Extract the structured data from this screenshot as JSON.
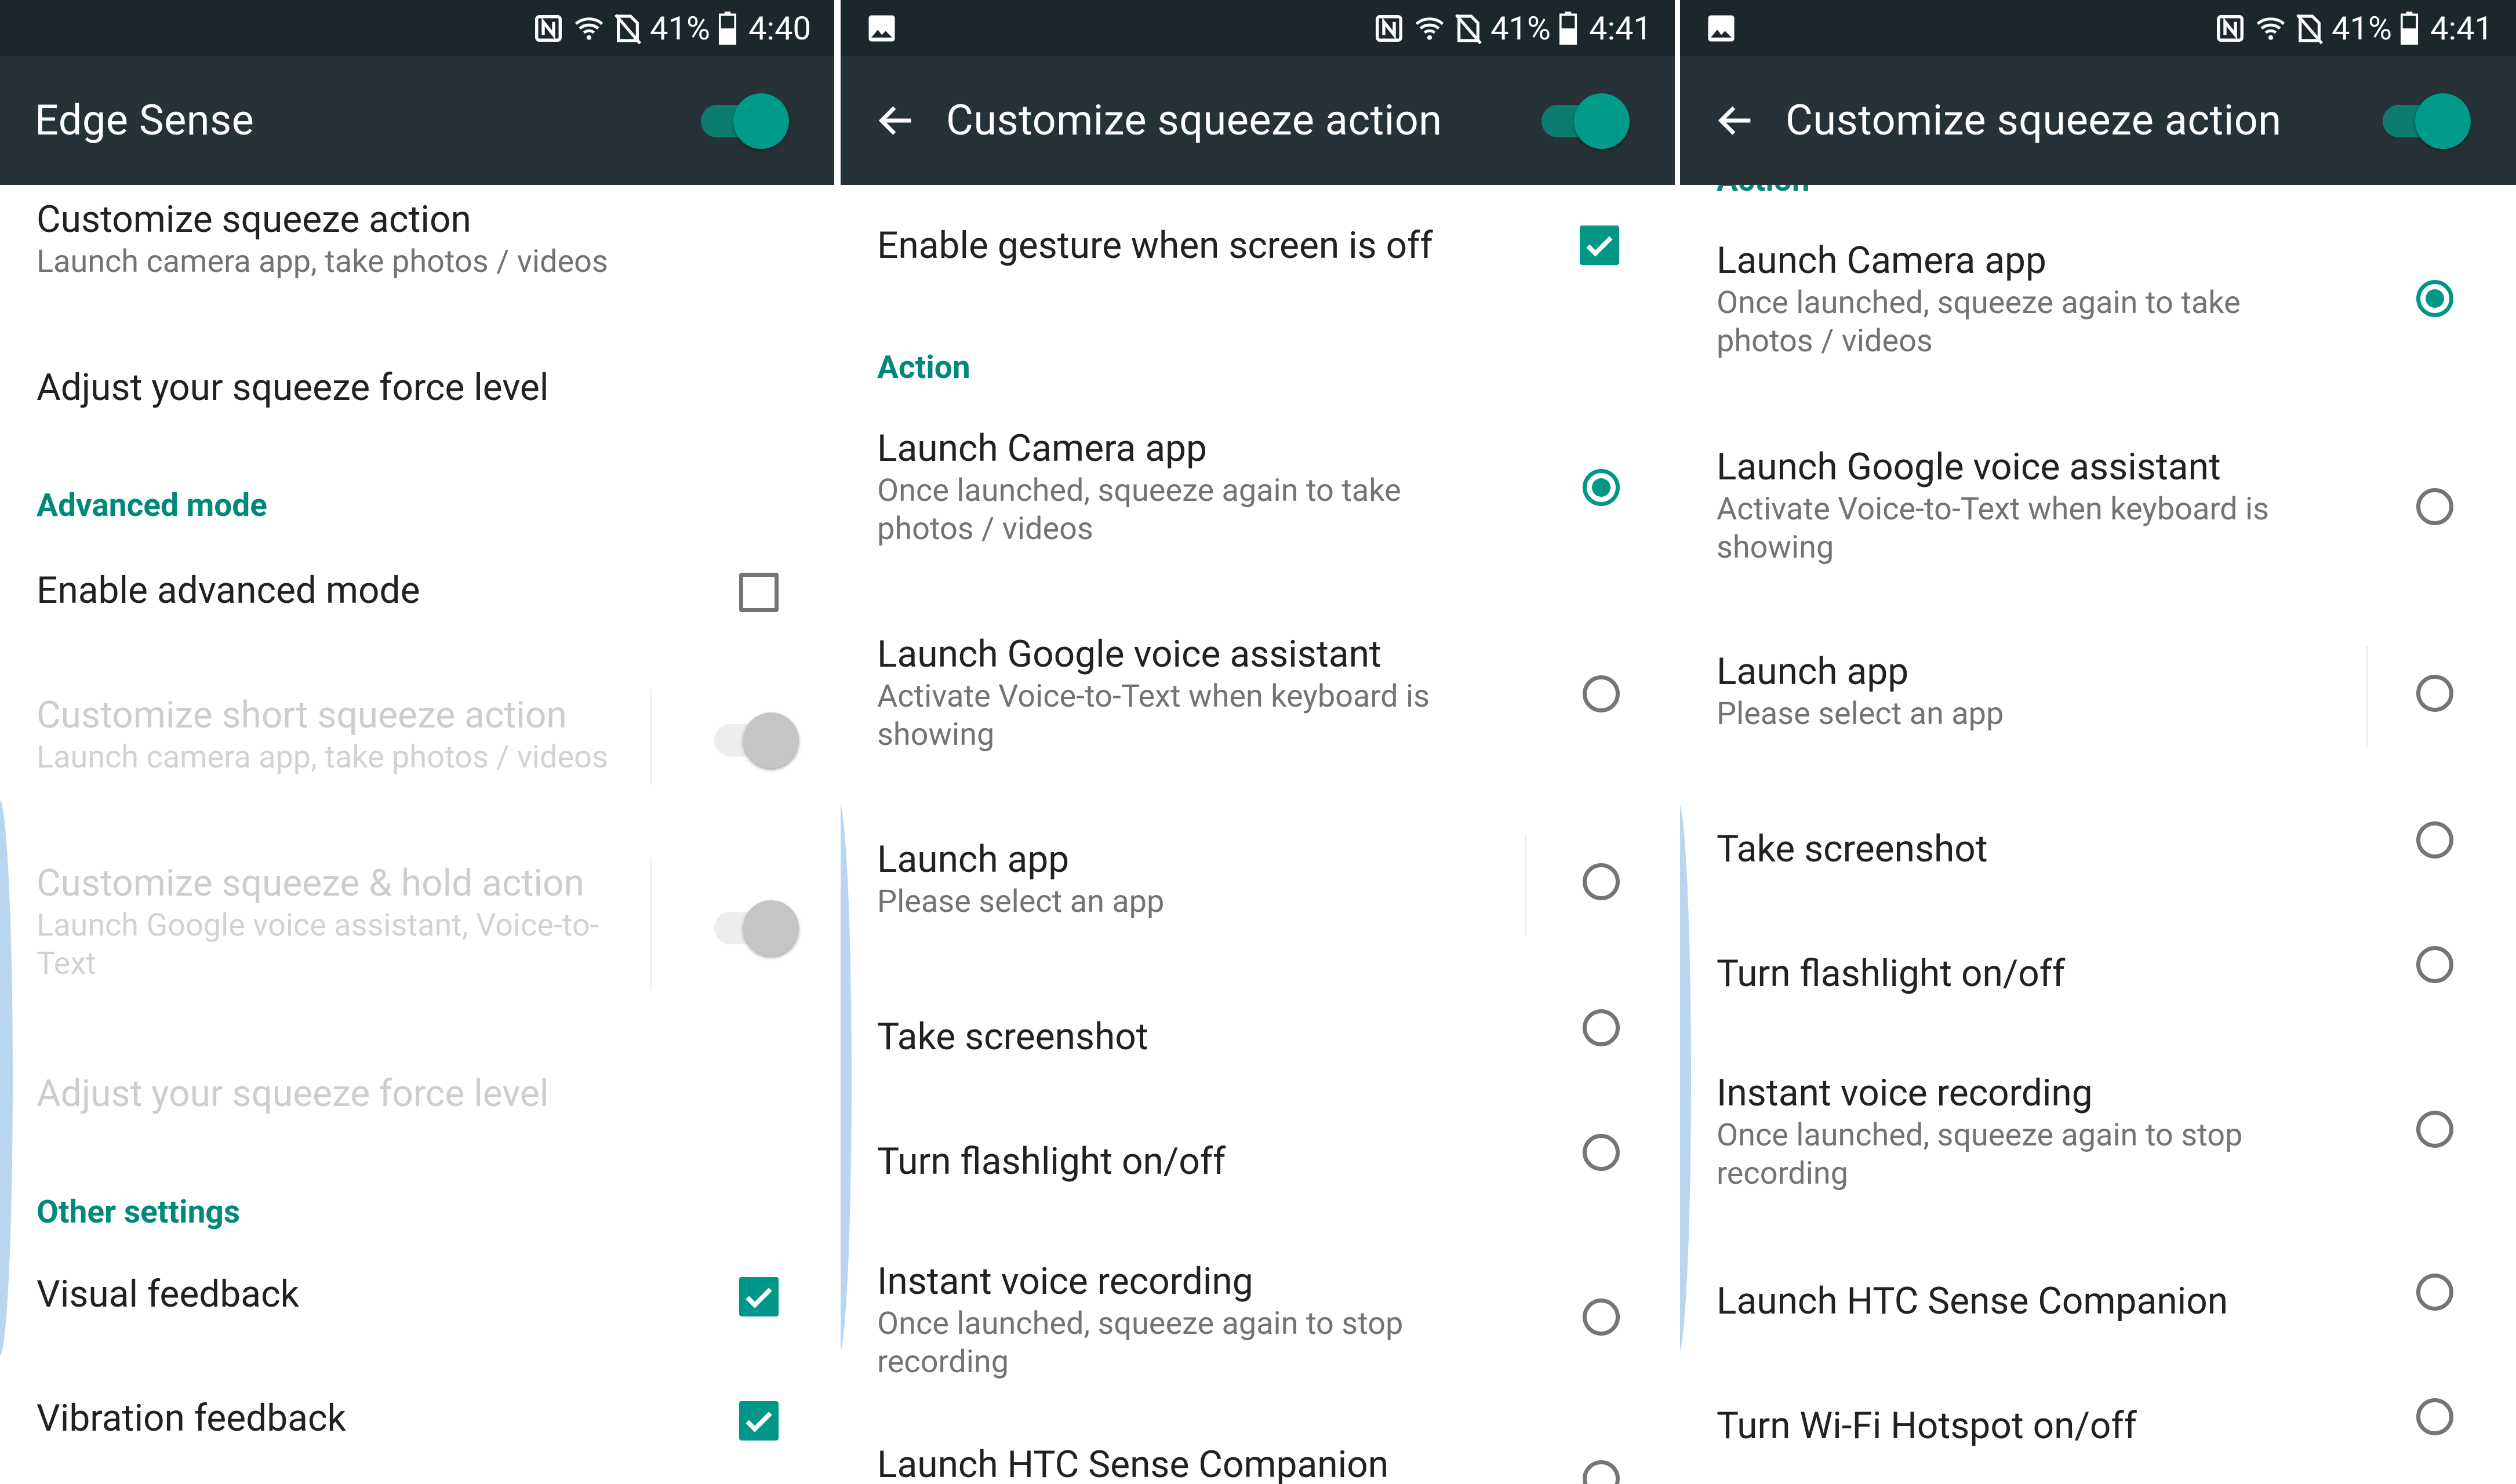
{
  "status_bar": {
    "battery": "41%",
    "panels": [
      {
        "time": "4:40"
      },
      {
        "time": "4:41"
      },
      {
        "time": "4:41"
      }
    ]
  },
  "panel1": {
    "title": "Edge Sense",
    "toggle_on": true,
    "items": [
      {
        "title": "Customize squeeze action",
        "subtitle": "Launch camera app, take photos / videos"
      },
      {
        "title": "Adjust your squeeze force level"
      },
      {
        "section": "Advanced mode"
      },
      {
        "title": "Enable advanced mode",
        "checked": false
      },
      {
        "title": "Customize short squeeze action",
        "subtitle": "Launch camera app, take photos / videos",
        "disabled": true,
        "toggle_on": false
      },
      {
        "title": "Customize squeeze & hold action",
        "subtitle": "Launch Google voice assistant, Voice-to-Text",
        "disabled": true,
        "toggle_on": false
      },
      {
        "title": "Adjust your squeeze force level",
        "disabled": true
      },
      {
        "section": "Other settings"
      },
      {
        "title": "Visual feedback",
        "checked": true
      },
      {
        "title": "Vibration feedback",
        "checked": true
      }
    ]
  },
  "panel2": {
    "title": "Customize squeeze action",
    "toggle_on": true,
    "enable_gesture": {
      "title": "Enable gesture when screen is off",
      "checked": true
    },
    "section": "Action",
    "options": [
      {
        "title": "Launch Camera app",
        "subtitle": "Once launched, squeeze again to take photos / videos",
        "selected": true
      },
      {
        "title": "Launch Google voice assistant",
        "subtitle": "Activate Voice-to-Text when keyboard is showing",
        "selected": false
      },
      {
        "title": "Launch app",
        "subtitle": "Please select an app",
        "selected": false
      },
      {
        "title": "Take screenshot",
        "selected": false
      },
      {
        "title": "Turn flashlight on/off",
        "selected": false
      },
      {
        "title": "Instant voice recording",
        "subtitle": "Once launched, squeeze again to stop recording",
        "selected": false
      },
      {
        "title": "Launch HTC Sense Companion",
        "selected": false
      }
    ]
  },
  "panel3": {
    "title": "Customize squeeze action",
    "toggle_on": true,
    "section": "Action",
    "options": [
      {
        "title": "Launch Camera app",
        "subtitle": "Once launched, squeeze again to take photos / videos",
        "selected": true
      },
      {
        "title": "Launch Google voice assistant",
        "subtitle": "Activate Voice-to-Text when keyboard is showing",
        "selected": false
      },
      {
        "title": "Launch app",
        "subtitle": "Please select an app",
        "selected": false
      },
      {
        "title": "Take screenshot",
        "selected": false
      },
      {
        "title": "Turn flashlight on/off",
        "selected": false
      },
      {
        "title": "Instant voice recording",
        "subtitle": "Once launched, squeeze again to stop recording",
        "selected": false
      },
      {
        "title": "Launch HTC Sense Companion",
        "selected": false
      },
      {
        "title": "Turn Wi-Fi Hotspot on/off",
        "selected": false
      }
    ]
  },
  "colors": {
    "status_bar": "#1c272b",
    "app_bar": "#263238",
    "accent": "#009688",
    "section_text": "#00897b",
    "edge_hint": "#b8d6f0"
  },
  "icons": [
    "nfc-icon",
    "wifi-icon",
    "no-sim-icon",
    "battery-icon",
    "image-notification-icon",
    "back-arrow-icon"
  ]
}
